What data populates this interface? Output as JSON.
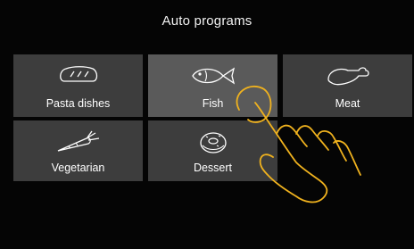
{
  "window": {
    "title": "Auto programs"
  },
  "programs": [
    {
      "label": "Pasta dishes",
      "icon": "bread-icon",
      "selected": false
    },
    {
      "label": "Fish",
      "icon": "fish-icon",
      "selected": true
    },
    {
      "label": "Meat",
      "icon": "drumstick-icon",
      "selected": false
    },
    {
      "label": "Vegetarian",
      "icon": "carrot-icon",
      "selected": false
    },
    {
      "label": "Dessert",
      "icon": "donut-icon",
      "selected": false
    }
  ],
  "colors": {
    "background": "#050505",
    "tile": "#3d3d3d",
    "tile_selected": "#5a5a5a",
    "touch_hint": "#f0b21e"
  }
}
